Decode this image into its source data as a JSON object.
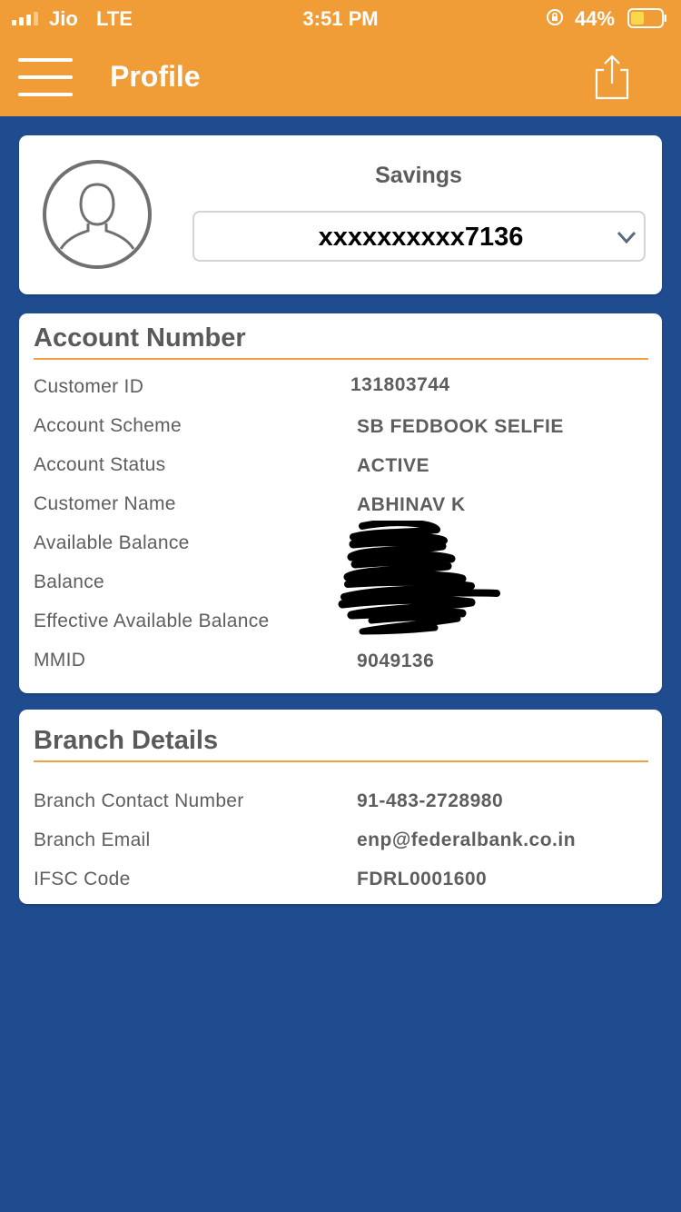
{
  "status_bar": {
    "carrier": "Jio",
    "network": "LTE",
    "time": "3:51 PM",
    "battery": "44%"
  },
  "header": {
    "title": "Profile",
    "menu_icon": "hamburger-menu-icon",
    "share_icon": "share-icon",
    "background_color": "#f09d38"
  },
  "profile_card": {
    "avatar_icon": "user-avatar-icon",
    "account_type": "Savings",
    "account_selector": {
      "selected_value": "xxxxxxxxxx7136",
      "icon": "chevron-down-icon"
    }
  },
  "account_section": {
    "title": "Account Number",
    "fields": [
      {
        "label": "Customer ID",
        "value": "131803744"
      },
      {
        "label": "Account Scheme",
        "value": "SB FEDBOOK SELFIE"
      },
      {
        "label": "Account Status",
        "value": "ACTIVE"
      },
      {
        "label": "Customer Name",
        "value": "ABHINAV K"
      },
      {
        "label": "Available Balance",
        "value": ""
      },
      {
        "label": "Balance",
        "value": ""
      },
      {
        "label": "Effective Available Balance",
        "value": ""
      },
      {
        "label": "MMID",
        "value": "9049136"
      }
    ]
  },
  "branch_section": {
    "title": "Branch Details",
    "fields": [
      {
        "label": "Branch Contact Number",
        "value": "91-483-2728980"
      },
      {
        "label": "Branch Email",
        "value": "enp@federalbank.co.in"
      },
      {
        "label": "IFSC Code",
        "value": "FDRL0001600"
      }
    ]
  },
  "colors": {
    "page_background": "#1f4c8f",
    "accent": "#f09d38"
  }
}
